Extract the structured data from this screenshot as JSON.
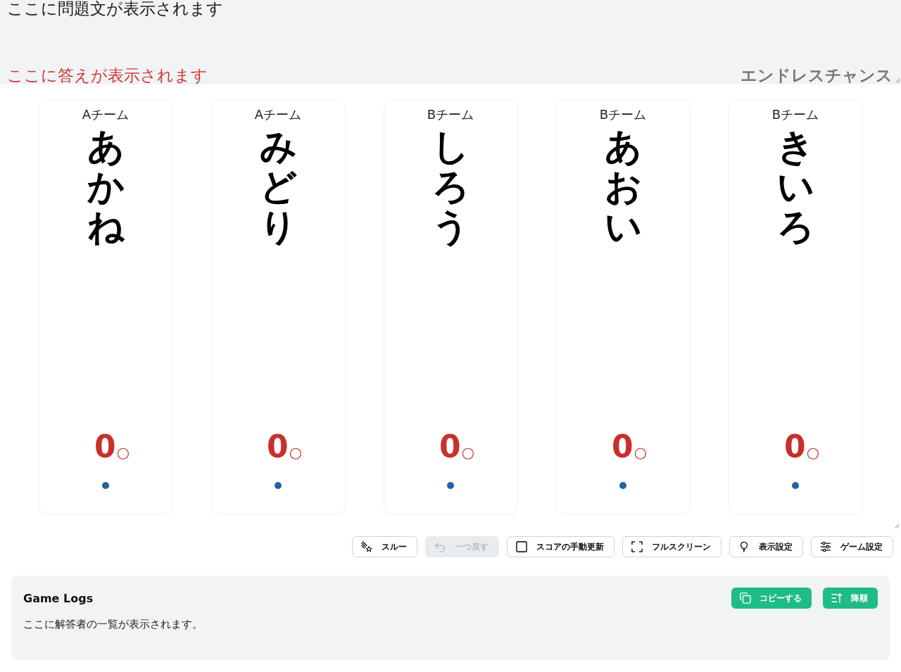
{
  "question": {
    "text": "ここに問題文が表示されます",
    "answer": "ここに答えが表示されます",
    "mode": "エンドレスチャンス"
  },
  "players": [
    {
      "team": "Aチーム",
      "name": "あかね",
      "score": "0",
      "mark": "○"
    },
    {
      "team": "Aチーム",
      "name": "みどり",
      "score": "0",
      "mark": "○"
    },
    {
      "team": "Bチーム",
      "name": "しろう",
      "score": "0",
      "mark": "○"
    },
    {
      "team": "Bチーム",
      "name": "あおい",
      "score": "0",
      "mark": "○"
    },
    {
      "team": "Bチーム",
      "name": "きいろ",
      "score": "0",
      "mark": "○"
    }
  ],
  "toolbar": [
    {
      "kind": "button",
      "label": "スルー",
      "disabled": false
    },
    {
      "kind": "button",
      "label": "一つ戻す",
      "disabled": true
    },
    {
      "kind": "toggle",
      "label": "スコアの手動更新",
      "disabled": false,
      "checked": false
    },
    {
      "kind": "button",
      "label": "フルスクリーン",
      "disabled": false
    },
    {
      "kind": "button",
      "label": "表示設定",
      "disabled": false
    },
    {
      "kind": "button",
      "label": "ゲーム設定",
      "disabled": false
    }
  ],
  "game_logs": {
    "title": "Game Logs",
    "buttons": [
      {
        "label": "コピーする"
      },
      {
        "label": "降順"
      }
    ],
    "empty_text": "ここに解答者の一覧が表示されます。"
  }
}
